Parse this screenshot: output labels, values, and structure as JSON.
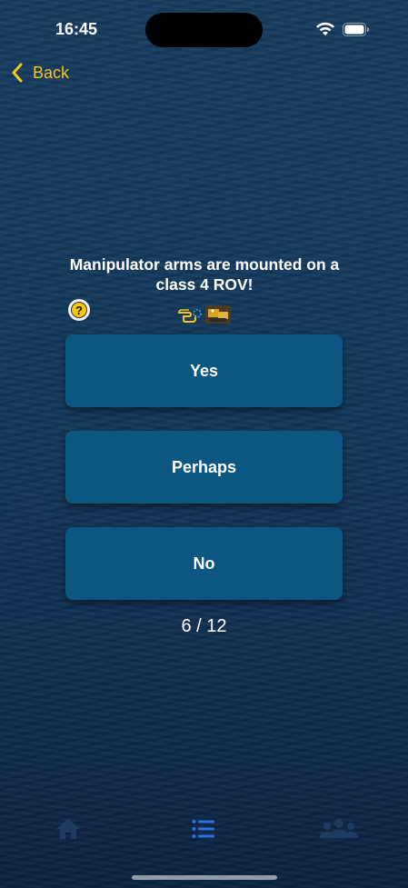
{
  "status_bar": {
    "time": "16:45"
  },
  "nav": {
    "back_label": "Back"
  },
  "question": {
    "text": "Manipulator arms are mounted on a class 4 ROV!"
  },
  "answers": [
    {
      "label": "Yes"
    },
    {
      "label": "Perhaps"
    },
    {
      "label": "No"
    }
  ],
  "progress": {
    "text": "6 / 12",
    "current": 6,
    "total": 12
  },
  "tab_bar": {
    "items": [
      {
        "icon": "home-icon",
        "active": false
      },
      {
        "icon": "list-icon",
        "active": true
      },
      {
        "icon": "people-icon",
        "active": false
      }
    ]
  },
  "colors": {
    "accent": "#f5c518",
    "button_bg": "#0c5682",
    "active_tab": "#2f6fdc",
    "inactive_tab": "#1e3c5f"
  }
}
